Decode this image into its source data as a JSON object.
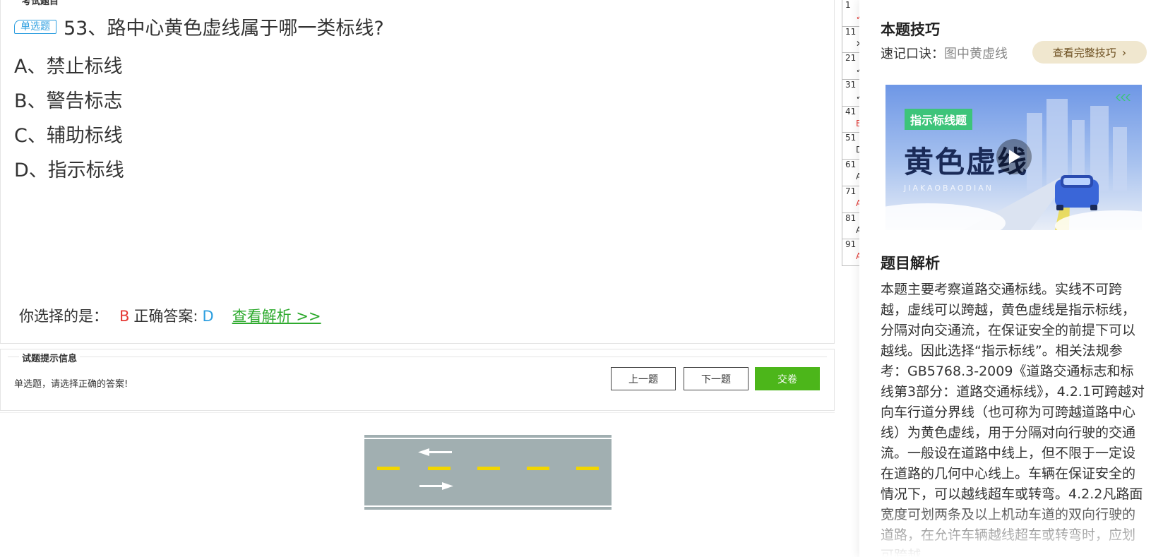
{
  "exam": {
    "section_legend": "考试题目",
    "question_type": "单选题",
    "question": "53、路中心黄色虚线属于哪一类标线?",
    "options": [
      "A、禁止标线",
      "B、警告标志",
      "C、辅助标线",
      "D、指示标线"
    ],
    "result": {
      "your_choice_label": "你选择的是：",
      "your_choice": "B",
      "correct_label": "正确答案:",
      "correct": "D",
      "view_analysis_link": "查看解析 >>"
    }
  },
  "hint": {
    "legend": "试题提示信息",
    "text": "单选题，请选择正确的答案!",
    "prev_button": "上一题",
    "next_button": "下一题",
    "submit_button": "交卷"
  },
  "answer_sheet": {
    "rows": [
      {
        "num": "1",
        "mark": "✓",
        "mark_color": "#e53935"
      },
      {
        "num": "11",
        "mark": "✕",
        "mark_color": "#333333"
      },
      {
        "num": "21",
        "mark": "✓",
        "mark_color": "#333333"
      },
      {
        "num": "31",
        "mark": "✓",
        "mark_color": "#333333"
      },
      {
        "num": "41",
        "mark": "B",
        "mark_color": "#e53935"
      },
      {
        "num": "51",
        "mark": "D",
        "mark_color": "#333333"
      },
      {
        "num": "61",
        "mark": "A",
        "mark_color": "#333333"
      },
      {
        "num": "71",
        "mark": "A",
        "mark_color": "#e53935"
      },
      {
        "num": "81",
        "mark": "A",
        "mark_color": "#333333"
      },
      {
        "num": "91",
        "mark": "A",
        "mark_color": "#e53935"
      }
    ]
  },
  "tips": {
    "title": "本题技巧",
    "mnemonic_label": "速记口诀：",
    "mnemonic_preview": "图中黄虚线",
    "view_full_button": "查看完整技巧",
    "video": {
      "tag": "指示标线题",
      "headline": "黄色虚线",
      "watermark": "JIAKAOBAODIAN"
    }
  },
  "analysis": {
    "title": "题目解析",
    "text": "本题主要考察道路交通标线。实线不可跨越，虚线可以跨越，黄色虚线是指示标线，分隔对向交通流，在保证安全的前提下可以越线。因此选择“指示标线”。相关法规参考：GB5768.3-2009《道路交通标志和标线第3部分：道路交通标线》，4.2.1可跨越对向车行道分界线（也可称为可跨越道路中心线）为黄色虚线，用于分隔对向行驶的交通流。一般设在道路中线上，但不限于一定设在道路的几何中心线上。车辆在保证安全的情况下，可以越线超车或转弯。4.2.2凡路面宽度可划两条及以上机动车道的双向行驶的道路，在允许车辆越线超车或转弯时，应划可跨越"
  },
  "colors": {
    "accent_green": "#4cb61a",
    "link_green": "#2eaa2e",
    "wrong_red": "#e53935",
    "correct_blue": "#2e9fe0",
    "lane_yellow": "#f2d600",
    "road_gray": "#a1afb1"
  }
}
